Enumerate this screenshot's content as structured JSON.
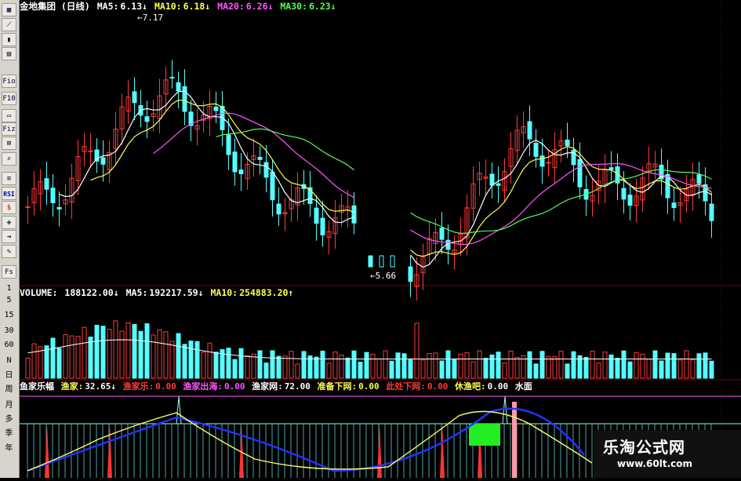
{
  "toolbar": {
    "icons": [
      "chart-icon",
      "line-chart-icon",
      "candle-icon",
      "bar-icon",
      "fio-icon",
      "f10-icon",
      "window-icon",
      "fiz-icon",
      "grid-icon",
      "search-icon",
      "list-icon",
      "rsi-icon",
      "dollar-icon",
      "move-icon",
      "export-icon",
      "pencil-icon",
      "fs-icon"
    ],
    "labels": {
      "fio": "Fio",
      "f10": "F10",
      "fiz": "Fiz",
      "rsi": "RSI",
      "fs": "Fs"
    },
    "periods": [
      "1",
      "5",
      "15",
      "30",
      "60",
      "N",
      "日",
      "周",
      "月",
      "多",
      "季",
      "年"
    ]
  },
  "main": {
    "title": "金地集团 (日线)",
    "ma5_label": "MA5:",
    "ma5_value": "6.13↓",
    "ma10_label": "MA10:",
    "ma10_value": "6.18↓",
    "ma20_label": "MA20:",
    "ma20_value": "6.26↓",
    "ma30_label": "MA30:",
    "ma30_value": "6.23↓",
    "high_mark": "7.17",
    "low_mark": "5.66"
  },
  "volume": {
    "label": "VOLUME:",
    "value": "188122.00↓",
    "ma5_label": "MA5:",
    "ma5_value": "192217.59↓",
    "ma10_label": "MA10:",
    "ma10_value": "254883.20↑"
  },
  "indicator": {
    "name": "鱼家乐幅",
    "yujia_label": "渔家:",
    "yujia_value": "32.65↓",
    "yujiale_label": "渔家乐:",
    "yujiale_value": "0.00",
    "chuhai_label": "渔家出海:",
    "chuhai_value": "0.00",
    "wang_label": "渔家网:",
    "wang_value": "72.00",
    "zhunbei_label": "准备下网:",
    "zhunbei_value": "0.00",
    "cichu_label": "此处下网:",
    "cichu_value": "0.00",
    "xiuyu_label": "休渔吧:",
    "xiuyu_value": "0.00",
    "shuimian_label": "水面"
  },
  "watermark": {
    "cn": "乐淘公式网",
    "url": "www.60lt.com"
  },
  "colors": {
    "up": "#ff3b3b",
    "down": "#54ffff",
    "ma5": "#ffffff",
    "ma10": "#ffff54",
    "ma20": "#ff54ff",
    "ma30": "#54ff54",
    "bg": "#000000",
    "panel_line": "#800000"
  }
}
